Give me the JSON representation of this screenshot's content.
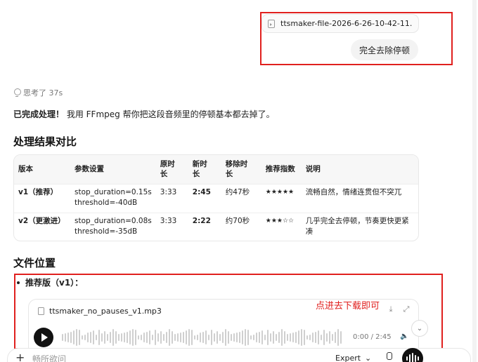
{
  "user_message": {
    "attachment_name": "ttsmaker-file-2026-6-26-10-42-11...",
    "text": "完全去除停顿"
  },
  "assistant": {
    "thought_label": "思考了 37s",
    "intro_bold": "已完成处理！",
    "intro_rest": " 我用 FFmpeg 帮你把这段音频里的停顿基本都去掉了。",
    "section_compare_title": "处理结果对比",
    "table": {
      "headers": [
        "版本",
        "参数设置",
        "原时长",
        "新时长",
        "移除时长",
        "推荐指数",
        "说明"
      ],
      "rows": [
        {
          "version": "v1（推荐）",
          "params_1": "stop_duration=0.15s",
          "params_2": "threshold=-40dB",
          "orig": "3:33",
          "new": "2:45",
          "removed": "约47秒",
          "stars": "★★★★★",
          "note": "流畅自然，情绪连贯但不突兀"
        },
        {
          "version": "v2（更激进）",
          "params_1": "stop_duration=0.08s",
          "params_2": "threshold=-35dB",
          "orig": "3:33",
          "new": "2:22",
          "removed": "约70秒",
          "stars": "★★★☆☆",
          "note": "几乎完全去停顿，节奏更快更紧凑"
        }
      ]
    },
    "section_files_title": "文件位置",
    "recommend_label": "推荐版（v1）：",
    "audio": {
      "file_name": "ttsmaker_no_pauses_v1.mp3",
      "time": "0:00 / 2:45"
    }
  },
  "annotation": {
    "text": "点进去下载即可",
    "color": "#e0201e"
  },
  "composer": {
    "placeholder": "畅所欲问",
    "model_label": "Expert",
    "model_caret": "⌄",
    "plus": "+"
  },
  "icons": {
    "download": "⤓",
    "expand": "⤢",
    "volume": "🔈",
    "chevron_down": "⌄"
  }
}
